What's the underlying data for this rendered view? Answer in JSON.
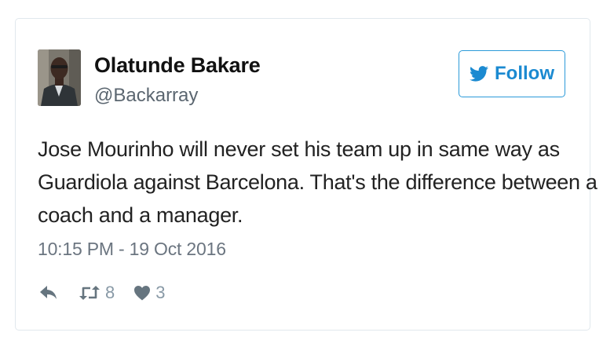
{
  "tweet": {
    "author": {
      "display_name": "Olatunde Bakare",
      "handle": "@Backarray",
      "avatar_icon": "profile-photo"
    },
    "follow_button": {
      "label": "Follow",
      "icon": "twitter-bird-icon"
    },
    "text_lines": [
      "Jose Mourinho will never set his team up in same way as",
      "Guardiola against Barcelona. That's the difference between a",
      "coach and a manager."
    ],
    "timestamp": "10:15 PM - 19 Oct 2016",
    "actions": {
      "reply_icon": "reply-icon",
      "retweet_icon": "retweet-icon",
      "retweet_count": "8",
      "like_icon": "heart-icon",
      "like_count": "3"
    }
  },
  "colors": {
    "accent": "#1b8ad1",
    "border": "#e1e8ed",
    "text": "#222222",
    "muted": "#6b7580",
    "action": "#8899a6"
  }
}
